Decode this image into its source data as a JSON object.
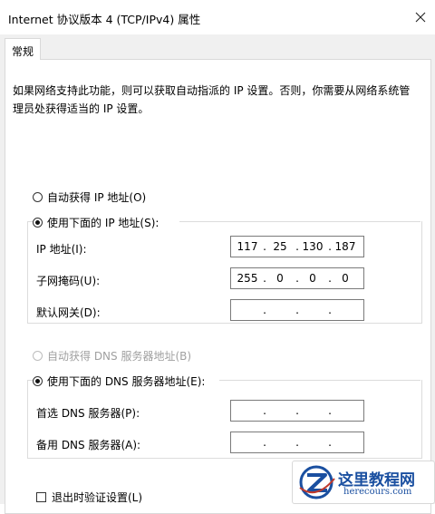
{
  "window": {
    "title": "Internet 协议版本 4 (TCP/IPv4) 属性"
  },
  "tabs": [
    {
      "label": "常规",
      "active": true
    }
  ],
  "description": "如果网络支持此功能，则可以获取自动指派的 IP 设置。否则，你需要从网络系统管理员处获得适当的 IP 设置。",
  "ip_settings": {
    "auto_label": "自动获得 IP 地址(O)",
    "manual_label": "使用下面的 IP 地址(S):",
    "mode": "manual",
    "fields": [
      {
        "label": "IP 地址(I):",
        "segments": [
          "117",
          "25",
          "130",
          "187"
        ]
      },
      {
        "label": "子网掩码(U):",
        "segments": [
          "255",
          "0",
          "0",
          "0"
        ]
      },
      {
        "label": "默认网关(D):",
        "segments": [
          "",
          "",
          "",
          ""
        ]
      }
    ]
  },
  "dns_settings": {
    "auto_label": "自动获得 DNS 服务器地址(B)",
    "manual_label": "使用下面的 DNS 服务器地址(E):",
    "mode": "manual",
    "fields": [
      {
        "label": "首选 DNS 服务器(P):",
        "segments": [
          "",
          "",
          "",
          ""
        ]
      },
      {
        "label": "备用 DNS 服务器(A):",
        "segments": [
          "",
          "",
          "",
          ""
        ]
      }
    ]
  },
  "validate": {
    "label": "退出时验证设置(L)",
    "checked": false
  },
  "watermark": {
    "name": "这里教程网",
    "url": "herecours.com"
  },
  "colors": {
    "watermark": "#1a4fa0"
  }
}
